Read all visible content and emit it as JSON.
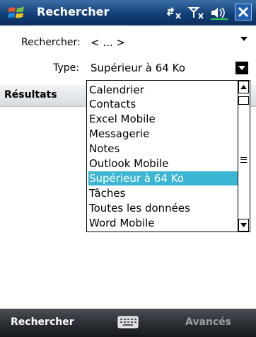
{
  "titlebar": {
    "title": "Rechercher"
  },
  "form": {
    "search_label": "Rechercher:",
    "search_value": "< ... >",
    "type_label": "Type:",
    "type_value": "Supérieur à 64 Ko"
  },
  "results_label": "Résultats",
  "dropdown": {
    "items": [
      "Calendrier",
      "Contacts",
      "Excel Mobile",
      "Messagerie",
      "Notes",
      "Outlook Mobile",
      "Supérieur à 64 Ko",
      "Tâches",
      "Toutes les données",
      "Word Mobile"
    ],
    "selected_index": 6
  },
  "softkeys": {
    "left": "Rechercher",
    "right": "Avancés"
  },
  "colors": {
    "title_bar": "#123f79",
    "selection": "#3cb6d2",
    "bottom_bar": "#2a2e34"
  },
  "icons": [
    "windows-logo-icon",
    "connectivity-icon",
    "signal-icon",
    "volume-icon",
    "close-icon",
    "keyboard-icon",
    "scroll-up-icon",
    "scroll-down-icon"
  ]
}
